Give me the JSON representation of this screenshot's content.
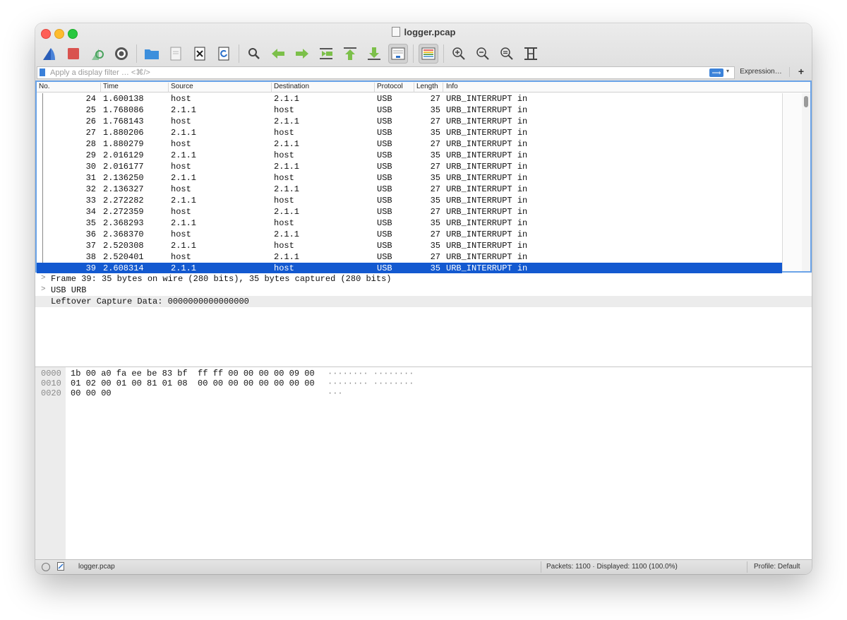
{
  "window": {
    "title": "logger.pcap"
  },
  "toolbar": {
    "buttons": [
      "start-capture-icon",
      "stop-capture-icon",
      "restart-capture-icon",
      "capture-options-icon",
      "open-file-icon",
      "save-file-icon",
      "close-file-icon",
      "reload-file-icon",
      "find-packet-icon",
      "go-back-icon",
      "go-forward-icon",
      "go-to-packet-icon",
      "first-packet-icon",
      "last-packet-icon",
      "autoscroll-icon",
      "colorize-icon",
      "zoom-in-icon",
      "zoom-out-icon",
      "normal-size-icon",
      "resize-columns-icon"
    ]
  },
  "filter": {
    "placeholder": "Apply a display filter … <⌘/>",
    "expression_label": "Expression…",
    "add_label": "+",
    "apply_glyph": "⟹",
    "dropdown_glyph": "▾"
  },
  "columns": {
    "no": "No.",
    "time": "Time",
    "source": "Source",
    "destination": "Destination",
    "protocol": "Protocol",
    "length": "Length",
    "info": "Info"
  },
  "packets": [
    {
      "no": "24",
      "time": "1.600138",
      "src": "host",
      "dst": "2.1.1",
      "proto": "USB",
      "len": "27",
      "info": "URB_INTERRUPT in"
    },
    {
      "no": "25",
      "time": "1.768086",
      "src": "2.1.1",
      "dst": "host",
      "proto": "USB",
      "len": "35",
      "info": "URB_INTERRUPT in"
    },
    {
      "no": "26",
      "time": "1.768143",
      "src": "host",
      "dst": "2.1.1",
      "proto": "USB",
      "len": "27",
      "info": "URB_INTERRUPT in"
    },
    {
      "no": "27",
      "time": "1.880206",
      "src": "2.1.1",
      "dst": "host",
      "proto": "USB",
      "len": "35",
      "info": "URB_INTERRUPT in"
    },
    {
      "no": "28",
      "time": "1.880279",
      "src": "host",
      "dst": "2.1.1",
      "proto": "USB",
      "len": "27",
      "info": "URB_INTERRUPT in"
    },
    {
      "no": "29",
      "time": "2.016129",
      "src": "2.1.1",
      "dst": "host",
      "proto": "USB",
      "len": "35",
      "info": "URB_INTERRUPT in"
    },
    {
      "no": "30",
      "time": "2.016177",
      "src": "host",
      "dst": "2.1.1",
      "proto": "USB",
      "len": "27",
      "info": "URB_INTERRUPT in"
    },
    {
      "no": "31",
      "time": "2.136250",
      "src": "2.1.1",
      "dst": "host",
      "proto": "USB",
      "len": "35",
      "info": "URB_INTERRUPT in"
    },
    {
      "no": "32",
      "time": "2.136327",
      "src": "host",
      "dst": "2.1.1",
      "proto": "USB",
      "len": "27",
      "info": "URB_INTERRUPT in"
    },
    {
      "no": "33",
      "time": "2.272282",
      "src": "2.1.1",
      "dst": "host",
      "proto": "USB",
      "len": "35",
      "info": "URB_INTERRUPT in"
    },
    {
      "no": "34",
      "time": "2.272359",
      "src": "host",
      "dst": "2.1.1",
      "proto": "USB",
      "len": "27",
      "info": "URB_INTERRUPT in"
    },
    {
      "no": "35",
      "time": "2.368293",
      "src": "2.1.1",
      "dst": "host",
      "proto": "USB",
      "len": "35",
      "info": "URB_INTERRUPT in"
    },
    {
      "no": "36",
      "time": "2.368370",
      "src": "host",
      "dst": "2.1.1",
      "proto": "USB",
      "len": "27",
      "info": "URB_INTERRUPT in"
    },
    {
      "no": "37",
      "time": "2.520308",
      "src": "2.1.1",
      "dst": "host",
      "proto": "USB",
      "len": "35",
      "info": "URB_INTERRUPT in"
    },
    {
      "no": "38",
      "time": "2.520401",
      "src": "host",
      "dst": "2.1.1",
      "proto": "USB",
      "len": "27",
      "info": "URB_INTERRUPT in"
    },
    {
      "no": "39",
      "time": "2.608314",
      "src": "2.1.1",
      "dst": "host",
      "proto": "USB",
      "len": "35",
      "info": "URB_INTERRUPT in",
      "selected": true
    }
  ],
  "details": [
    {
      "arrow": ">",
      "text": "Frame 39: 35 bytes on wire (280 bits), 35 bytes captured (280 bits)"
    },
    {
      "arrow": ">",
      "text": "USB URB"
    },
    {
      "arrow": "",
      "text": "Leftover Capture Data: 0000000000000000",
      "highlight": true
    }
  ],
  "bytes": [
    {
      "offset": "0000",
      "hex": "1b 00 a0 fa ee be 83 bf  ff ff 00 00 00 00 09 00",
      "ascii": "········ ········"
    },
    {
      "offset": "0010",
      "hex": "01 02 00 01 00 81 01 08  00 00 00 00 00 00 00 00",
      "ascii": "········ ········"
    },
    {
      "offset": "0020",
      "hex": "00 00 00",
      "ascii": "···"
    }
  ],
  "status": {
    "file": "logger.pcap",
    "packets": "Packets: 1100 · Displayed: 1100 (100.0%)",
    "profile": "Profile: Default"
  },
  "colors": {
    "selection": "#1359d0",
    "accent": "#3b82d9"
  }
}
